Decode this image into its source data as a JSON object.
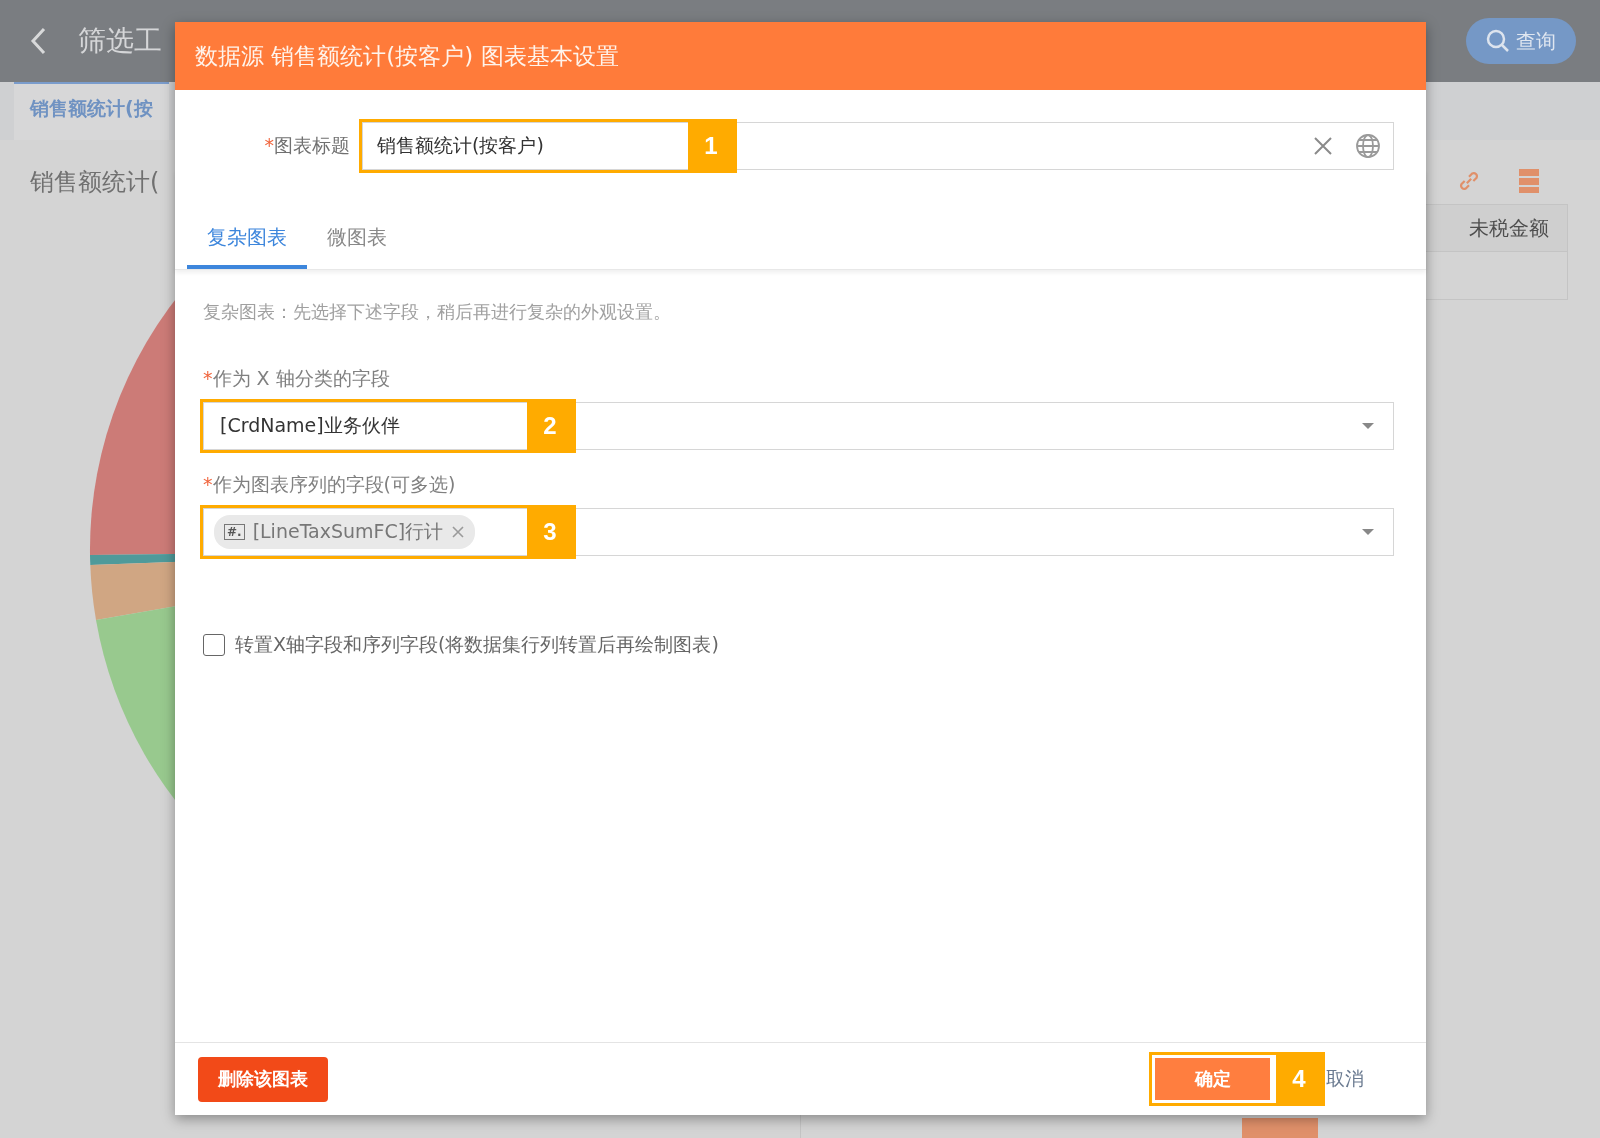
{
  "background_app": {
    "title": "筛选工",
    "search_button": "查询",
    "tab": "销售额统计(按",
    "chart_title": "销售额统计(",
    "table_header": "未税金额"
  },
  "dialog": {
    "title": "数据源 销售额统计(按客户) 图表基本设置",
    "title_field": {
      "required_mark": "*",
      "label": "图表标题",
      "value": "销售额统计(按客户)",
      "callout": "1"
    },
    "tabs": [
      {
        "label": "复杂图表",
        "selected": true
      },
      {
        "label": "微图表",
        "selected": false
      }
    ],
    "hint": "复杂图表：先选择下述字段，稍后再进行复杂的外观设置。",
    "fields": [
      {
        "kind": "select",
        "required_mark": "*",
        "label": "作为 X 轴分类的字段",
        "value": "[CrdName]业务伙伴",
        "callout": "2"
      },
      {
        "kind": "tags",
        "required_mark": "*",
        "label": "作为图表序列的字段(可多选)",
        "tags": [
          {
            "icon": "#.",
            "label": "[LineTaxSumFC]行计"
          }
        ],
        "callout": "3"
      }
    ],
    "transpose": {
      "checked": false,
      "label": "转置X轴字段和序列字段(将数据集行列转置后再绘制图表)"
    },
    "delete_button": "删除该图表",
    "ok_button": {
      "label": "确定",
      "callout": "4"
    },
    "cancel_button": "取消"
  }
}
